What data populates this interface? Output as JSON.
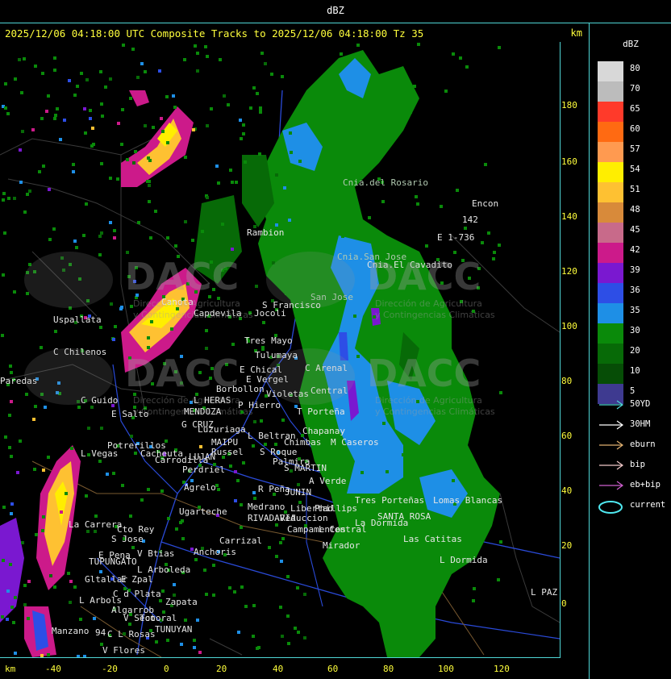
{
  "window": {
    "title": "dBZ"
  },
  "header": {
    "caption": "2025/12/06 04:18:00 UTC Composite Tracks to 2025/12/06 04:18:00 Tz 35",
    "unit": "km"
  },
  "axes": {
    "x_unit": "km",
    "x_ticks": [
      "-40",
      "-20",
      "0",
      "20",
      "40",
      "60",
      "80",
      "100",
      "120"
    ],
    "y_ticks": [
      "180",
      "160",
      "140",
      "120",
      "100",
      "80",
      "60",
      "40",
      "20",
      "0"
    ]
  },
  "colorbar": {
    "title": "dBZ",
    "levels": [
      {
        "label": "80",
        "color": "#d8d8d8"
      },
      {
        "label": "70",
        "color": "#bcbcbc"
      },
      {
        "label": "65",
        "color": "#ff3a2a"
      },
      {
        "label": "60",
        "color": "#ff6a12"
      },
      {
        "label": "57",
        "color": "#ff9a50"
      },
      {
        "label": "54",
        "color": "#ffee00"
      },
      {
        "label": "51",
        "color": "#fec132"
      },
      {
        "label": "48",
        "color": "#d88a3a"
      },
      {
        "label": "45",
        "color": "#c86a8a"
      },
      {
        "label": "42",
        "color": "#cc1a8a"
      },
      {
        "label": "39",
        "color": "#7a18d0"
      },
      {
        "label": "36",
        "color": "#2d4ee6"
      },
      {
        "label": "35",
        "color": "#1e8fe6"
      },
      {
        "label": "30",
        "color": "#0a8a0a"
      },
      {
        "label": "20",
        "color": "#076a07"
      },
      {
        "label": "10",
        "color": "#064d06"
      },
      {
        "label": "5",
        "color": "#3e3a90"
      }
    ]
  },
  "track_legend": [
    {
      "label": "50YD",
      "color": "#4fd6d6",
      "kind": "arrow"
    },
    {
      "label": "30HM",
      "color": "#ffffff",
      "kind": "arrow"
    },
    {
      "label": "eburn",
      "color": "#e0b070",
      "kind": "arrow"
    },
    {
      "label": "bip",
      "color": "#f0c8c8",
      "kind": "arrow"
    },
    {
      "label": "eb+bip",
      "color": "#d060d0",
      "kind": "arrow"
    },
    {
      "label": "current",
      "color": "#4fe8f0",
      "kind": "ellipse"
    }
  ],
  "watermark": {
    "brand": "DACC",
    "line1": "Dirección de Agricultura",
    "line2": "y Contingencias Climáticas"
  },
  "places": [
    {
      "name": "Cnia.del Rosario"
    },
    {
      "name": "Encon"
    },
    {
      "name": "142"
    },
    {
      "name": "E 1-736"
    },
    {
      "name": "Rambion"
    },
    {
      "name": "Cnia.San Jose"
    },
    {
      "name": "Cnia.El Cavadito"
    },
    {
      "name": "San Jose"
    },
    {
      "name": "S Francisco"
    },
    {
      "name": "Jocoli"
    },
    {
      "name": "Canota"
    },
    {
      "name": "Capdevila"
    },
    {
      "name": "Uspallata"
    },
    {
      "name": "C Chilenos"
    },
    {
      "name": "Paredas"
    },
    {
      "name": "Tres Mayo"
    },
    {
      "name": "Tulumaya"
    },
    {
      "name": "C Arenal"
    },
    {
      "name": "E Chical"
    },
    {
      "name": "E Vergel"
    },
    {
      "name": "Borbollon"
    },
    {
      "name": "Violetas"
    },
    {
      "name": "Central"
    },
    {
      "name": "P Hierro"
    },
    {
      "name": "C Guido"
    },
    {
      "name": "E Salto"
    },
    {
      "name": "L HERAS"
    },
    {
      "name": "MENDOZA"
    },
    {
      "name": "G CRUZ"
    },
    {
      "name": "Luzuriaga"
    },
    {
      "name": "T Porteña"
    },
    {
      "name": "L Beltran"
    },
    {
      "name": "Chimbas"
    },
    {
      "name": "Chapanay"
    },
    {
      "name": "M Caseros"
    },
    {
      "name": "MAIPU"
    },
    {
      "name": "Russel"
    },
    {
      "name": "S Roque"
    },
    {
      "name": "Palmira"
    },
    {
      "name": "Potrerillos"
    },
    {
      "name": "Cacheuta"
    },
    {
      "name": "L Vegas"
    },
    {
      "name": "LUJAN"
    },
    {
      "name": "Carrodilla"
    },
    {
      "name": "Perdriel"
    },
    {
      "name": "Agrelo"
    },
    {
      "name": "S MARTIN"
    },
    {
      "name": "A Verde"
    },
    {
      "name": "R Peña"
    },
    {
      "name": "JUNIN"
    },
    {
      "name": "Ugarteche"
    },
    {
      "name": "Medrano"
    },
    {
      "name": "RIVADAVIA"
    },
    {
      "name": "Reduccion"
    },
    {
      "name": "Libertad"
    },
    {
      "name": "Phillips"
    },
    {
      "name": "La Dormida"
    },
    {
      "name": "Tres Porteñas"
    },
    {
      "name": "Lomas Blancas"
    },
    {
      "name": "SANTA ROSA"
    },
    {
      "name": "La Carrera"
    },
    {
      "name": "Cto Rey"
    },
    {
      "name": "S Jose"
    },
    {
      "name": "Carrizal"
    },
    {
      "name": "Campamentos"
    },
    {
      "name": "L Central"
    },
    {
      "name": "Mirador"
    },
    {
      "name": "Las Catitas"
    },
    {
      "name": "L Dormida"
    },
    {
      "name": "E Pena"
    },
    {
      "name": "TUPUNGATO"
    },
    {
      "name": "V Btias"
    },
    {
      "name": "Anchoris"
    },
    {
      "name": "L Arboleda"
    },
    {
      "name": "Gltallar"
    },
    {
      "name": "E Zpal"
    },
    {
      "name": "C d Plata"
    },
    {
      "name": "L Arbols"
    },
    {
      "name": "Zapata"
    },
    {
      "name": "Algarrob"
    },
    {
      "name": "V Seco"
    },
    {
      "name": "Totoral"
    },
    {
      "name": "TUNUYAN"
    },
    {
      "name": "Manzano"
    },
    {
      "name": "94"
    },
    {
      "name": "C L Rosas"
    },
    {
      "name": "V Flores"
    },
    {
      "name": "L PAZ"
    }
  ]
}
